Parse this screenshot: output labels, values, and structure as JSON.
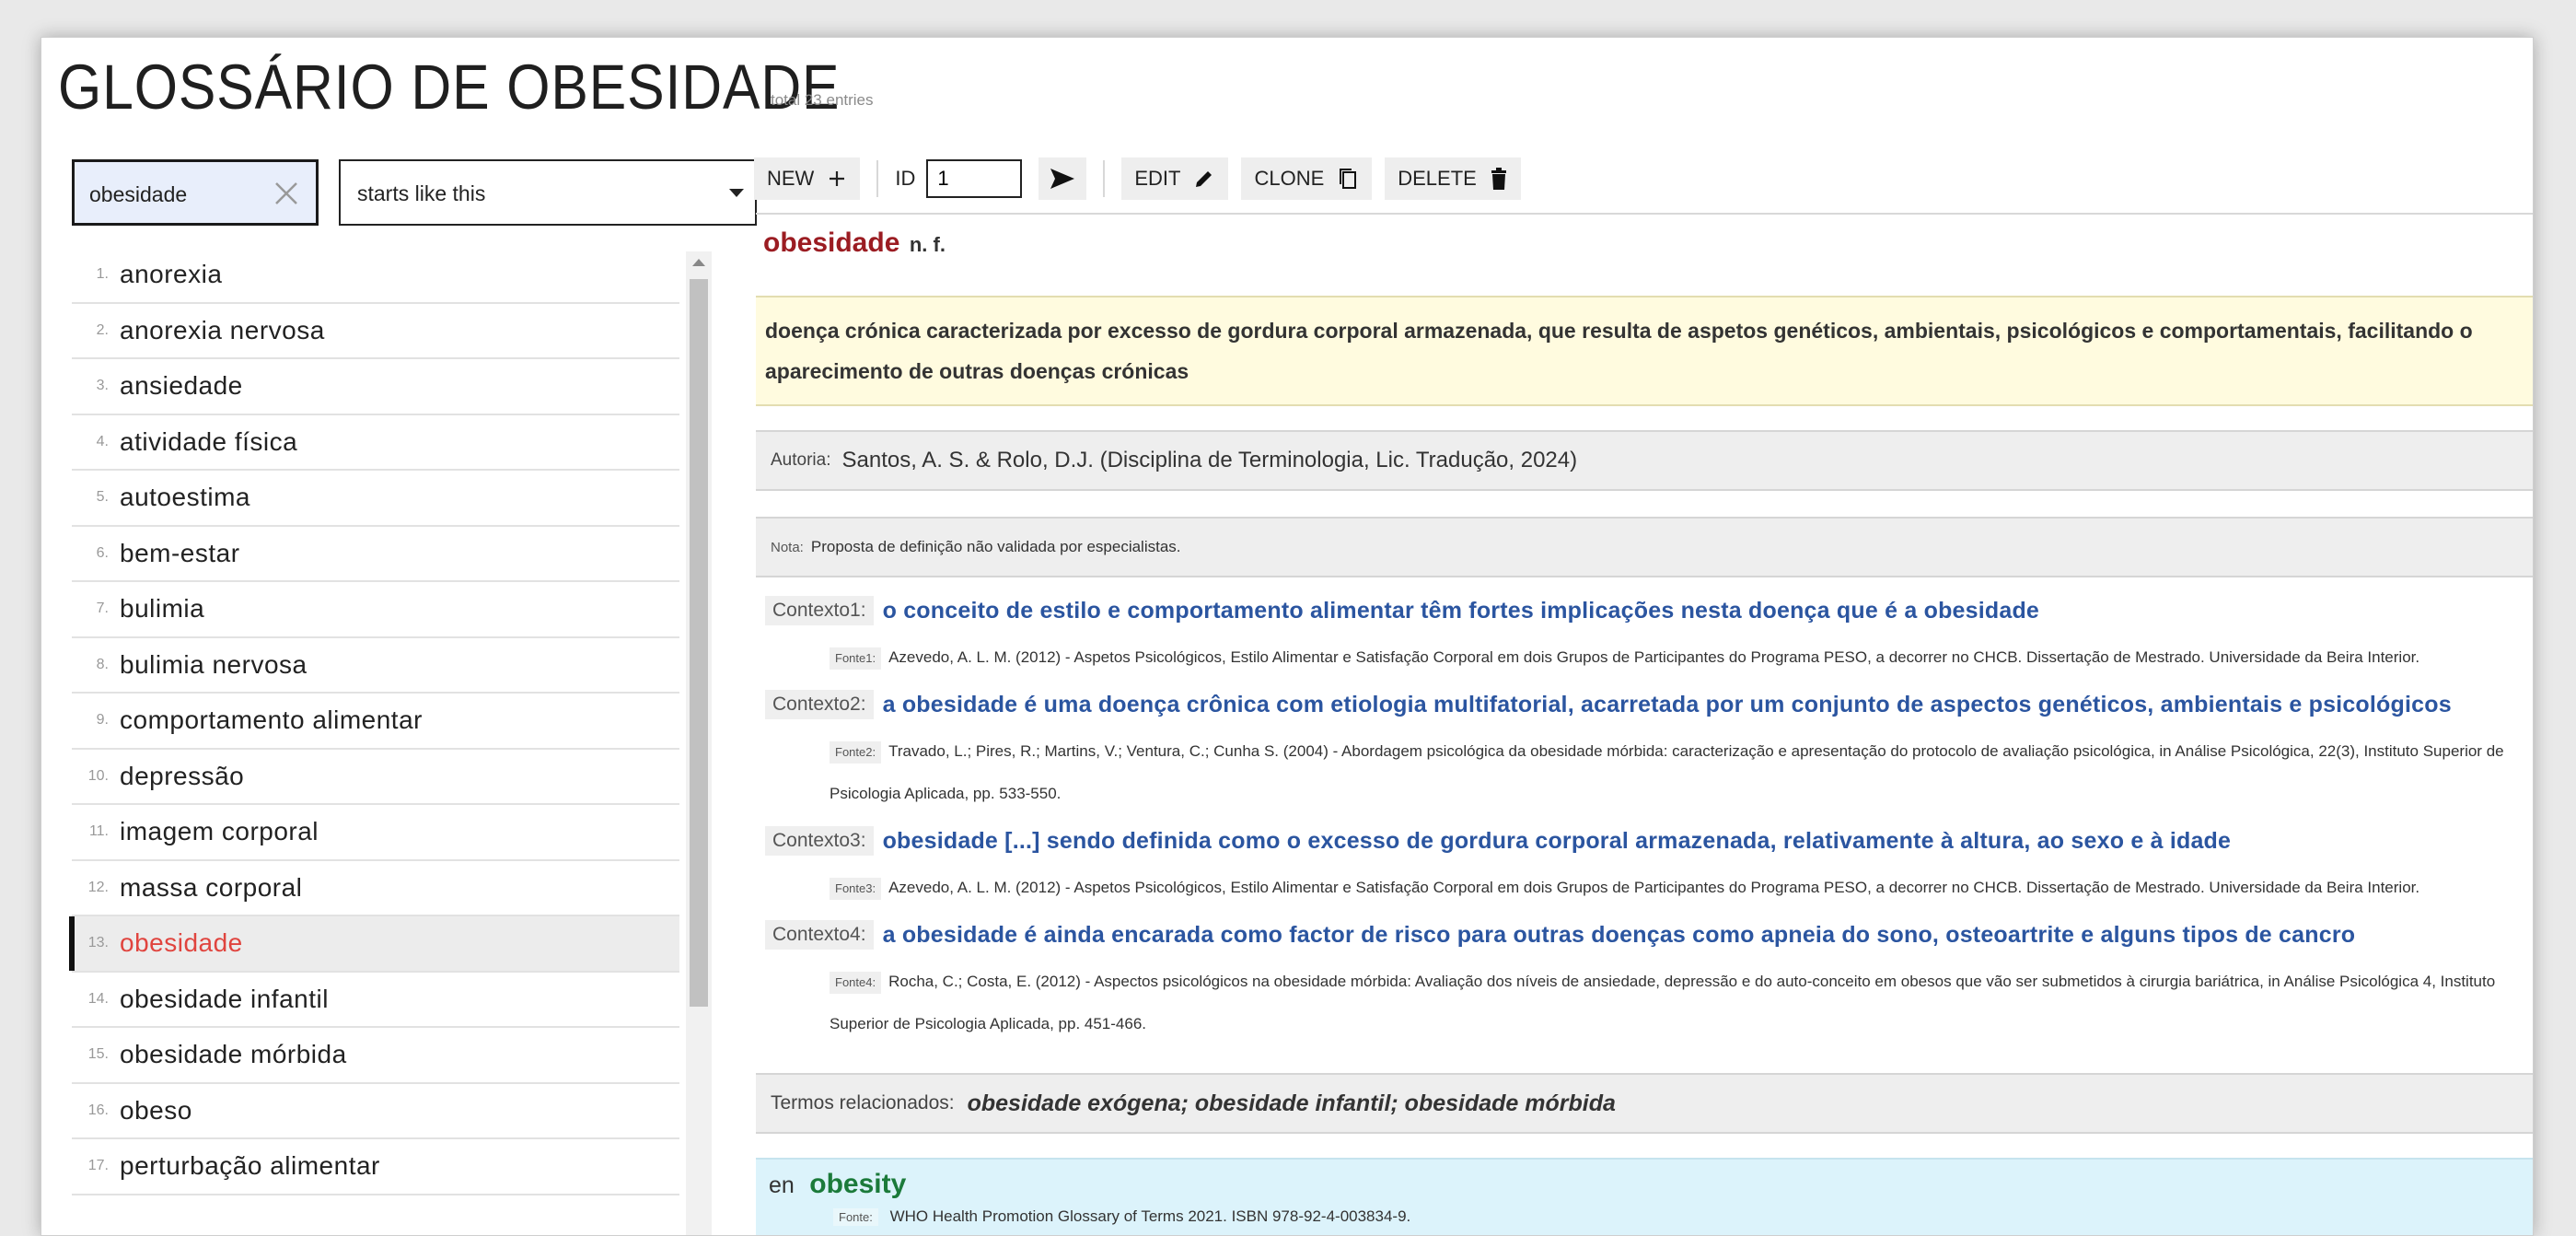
{
  "app": {
    "title": "GLOSSÁRIO DE OBESIDADE",
    "total": "total 23 entries"
  },
  "search": {
    "value": "obesidade",
    "mode": "starts like this"
  },
  "list": {
    "items": [
      {
        "n": "1.",
        "term": "anorexia"
      },
      {
        "n": "2.",
        "term": "anorexia nervosa"
      },
      {
        "n": "3.",
        "term": "ansiedade"
      },
      {
        "n": "4.",
        "term": "atividade física"
      },
      {
        "n": "5.",
        "term": "autoestima"
      },
      {
        "n": "6.",
        "term": "bem-estar"
      },
      {
        "n": "7.",
        "term": "bulimia"
      },
      {
        "n": "8.",
        "term": "bulimia nervosa"
      },
      {
        "n": "9.",
        "term": "comportamento alimentar"
      },
      {
        "n": "10.",
        "term": "depressão"
      },
      {
        "n": "11.",
        "term": "imagem corporal"
      },
      {
        "n": "12.",
        "term": "massa corporal"
      },
      {
        "n": "13.",
        "term": "obesidade"
      },
      {
        "n": "14.",
        "term": "obesidade infantil"
      },
      {
        "n": "15.",
        "term": "obesidade mórbida"
      },
      {
        "n": "16.",
        "term": "obeso"
      },
      {
        "n": "17.",
        "term": "perturbação alimentar"
      }
    ],
    "selected_index": 12
  },
  "toolbar": {
    "new_label": "NEW",
    "id_label": "ID",
    "id_value": "1",
    "edit_label": "EDIT",
    "clone_label": "CLONE",
    "delete_label": "DELETE"
  },
  "entry": {
    "headword": "obesidade",
    "pos": "n. f.",
    "definition": "doença crónica caracterizada por excesso de gordura corporal armazenada, que resulta de aspetos genéticos, ambientais, psicológicos e comportamentais, facilitando o aparecimento de outras doenças crónicas",
    "autoria_label": "Autoria:",
    "autoria": "Santos, A. S. & Rolo, D.J. (Disciplina de Terminologia, Lic. Tradução, 2024)",
    "nota_label": "Nota:",
    "nota": "Proposta de definição não validada por especialistas.",
    "contexts": [
      {
        "label": "Contexto1:",
        "text": "o conceito de estilo e comportamento alimentar têm fortes implicações nesta doença que é a obesidade",
        "fonte_label": "Fonte1:",
        "fonte": "Azevedo, A. L. M. (2012) - Aspetos Psicológicos, Estilo Alimentar e Satisfação Corporal em dois Grupos de Participantes do Programa PESO, a decorrer no CHCB. Dissertação de Mestrado. Universidade da Beira Interior."
      },
      {
        "label": "Contexto2:",
        "text": "a obesidade é uma doença crônica com etiologia multifatorial, acarretada por um conjunto de aspectos genéticos, ambientais e psicológicos",
        "fonte_label": "Fonte2:",
        "fonte": "Travado, L.; Pires, R.; Martins, V.; Ventura, C.; Cunha S. (2004) - Abordagem psicológica da obesidade mórbida: caracterização e apresentação do protocolo de avaliação psicológica, in Análise Psicológica, 22(3), Instituto Superior de Psicologia Aplicada, pp. 533-550."
      },
      {
        "label": "Contexto3:",
        "text": "obesidade [...] sendo definida como o excesso de gordura corporal armazenada, relativamente à altura, ao sexo e à idade",
        "fonte_label": "Fonte3:",
        "fonte": "Azevedo, A. L. M. (2012) - Aspetos Psicológicos, Estilo Alimentar e Satisfação Corporal em dois Grupos de Participantes do Programa PESO, a decorrer no CHCB. Dissertação de Mestrado. Universidade da Beira Interior."
      },
      {
        "label": "Contexto4:",
        "text": "a obesidade é ainda encarada como factor de risco para outras doenças como apneia do sono, osteoartrite e alguns tipos de cancro",
        "fonte_label": "Fonte4:",
        "fonte": "Rocha, C.; Costa, E. (2012) - Aspectos psicológicos na obesidade mórbida: Avaliação dos níveis de ansiedade, depressão e do auto-conceito em obesos que vão ser submetidos à cirurgia bariátrica, in Análise Psicológica 4, Instituto Superior de Psicologia Aplicada, pp. 451-466."
      }
    ],
    "related_label": "Termos relacionados:",
    "related": "obesidade exógena; obesidade infantil; obesidade mórbida",
    "equivalent": {
      "lang": "en",
      "term": "obesity",
      "fonte_label": "Fonte:",
      "fonte": "WHO Health Promotion Glossary of Terms 2021. ISBN 978-92-4-003834-9."
    }
  },
  "colors": {
    "headword": "#9b1c22",
    "selected_term": "#e0443e",
    "context_text": "#2b55a0",
    "equivalent": "#1b7a3a",
    "definition_bg": "#fffbdf",
    "equivalent_bg": "#dcf3fb"
  },
  "icons": [
    "close-icon",
    "chevron-down-icon",
    "plus-icon",
    "send-arrow-icon",
    "pencil-icon",
    "copy-icon",
    "trash-icon"
  ]
}
